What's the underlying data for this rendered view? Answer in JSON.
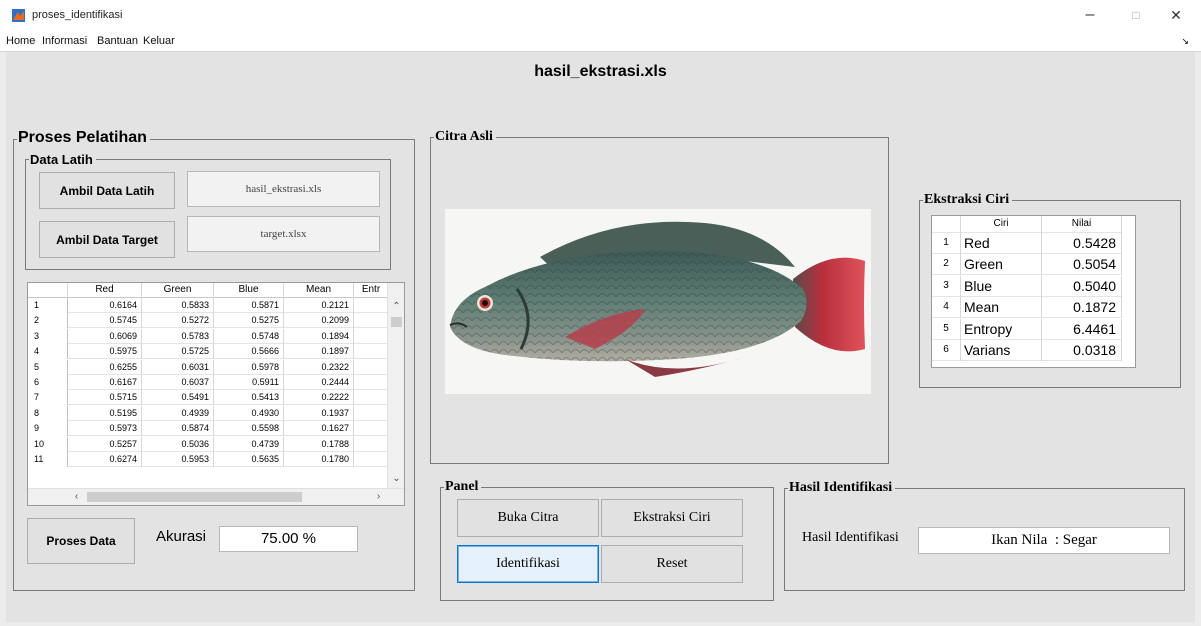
{
  "window": {
    "title": "proses_identifikasi",
    "minimize": "–",
    "maximize": "□",
    "close": "✕"
  },
  "menu": {
    "items": [
      "Home",
      "Informasi",
      "Bantuan",
      "Keluar"
    ],
    "overflow": "↘"
  },
  "main_title": "hasil_ekstrasi.xls",
  "pelatihan": {
    "title": "Proses Pelatihan",
    "data_latih": {
      "title": "Data Latih",
      "ambil_latih_label": "Ambil Data Latih",
      "latih_file": "hasil_ekstrasi.xls",
      "ambil_target_label": "Ambil Data Target",
      "target_file": "target.xlsx"
    },
    "table": {
      "columns": [
        "",
        "Red",
        "Green",
        "Blue",
        "Mean",
        "Entr"
      ],
      "rows": [
        [
          "1",
          "0.6164",
          "0.5833",
          "0.5871",
          "0.2121"
        ],
        [
          "2",
          "0.5745",
          "0.5272",
          "0.5275",
          "0.2099"
        ],
        [
          "3",
          "0.6069",
          "0.5783",
          "0.5748",
          "0.1894"
        ],
        [
          "4",
          "0.5975",
          "0.5725",
          "0.5666",
          "0.1897"
        ],
        [
          "5",
          "0.6255",
          "0.6031",
          "0.5978",
          "0.2322"
        ],
        [
          "6",
          "0.6167",
          "0.6037",
          "0.5911",
          "0.2444"
        ],
        [
          "7",
          "0.5715",
          "0.5491",
          "0.5413",
          "0.2222"
        ],
        [
          "8",
          "0.5195",
          "0.4939",
          "0.4930",
          "0.1937"
        ],
        [
          "9",
          "0.5973",
          "0.5874",
          "0.5598",
          "0.1627"
        ],
        [
          "10",
          "0.5257",
          "0.5036",
          "0.4739",
          "0.1788"
        ],
        [
          "11",
          "0.6274",
          "0.5953",
          "0.5635",
          "0.1780"
        ]
      ]
    },
    "proses_label": "Proses Data",
    "akurasi_label": "Akurasi",
    "akurasi_value": "75.00 %"
  },
  "citra_asli": {
    "title": "Citra Asli"
  },
  "panel": {
    "title": "Panel",
    "buka_label": "Buka Citra",
    "ekstraksi_label": "Ekstraksi Ciri",
    "identifikasi_label": "Identifikasi",
    "reset_label": "Reset"
  },
  "ekstraksi": {
    "title": "Ekstraksi Ciri",
    "columns": [
      "",
      "Ciri",
      "Nilai"
    ],
    "rows": [
      [
        "1",
        "Red",
        "0.5428"
      ],
      [
        "2",
        "Green",
        "0.5054"
      ],
      [
        "3",
        "Blue",
        "0.5040"
      ],
      [
        "4",
        "Mean",
        "0.1872"
      ],
      [
        "5",
        "Entropy",
        "6.4461"
      ],
      [
        "6",
        "Varians",
        "0.0318"
      ]
    ]
  },
  "hasil": {
    "title": "Hasil Identifikasi",
    "label": "Hasil Identifikasi",
    "value": "Ikan Nila  : Segar"
  },
  "colors": {
    "focus_border": "#0078d7",
    "panel_bg": "#e3e3e3"
  }
}
